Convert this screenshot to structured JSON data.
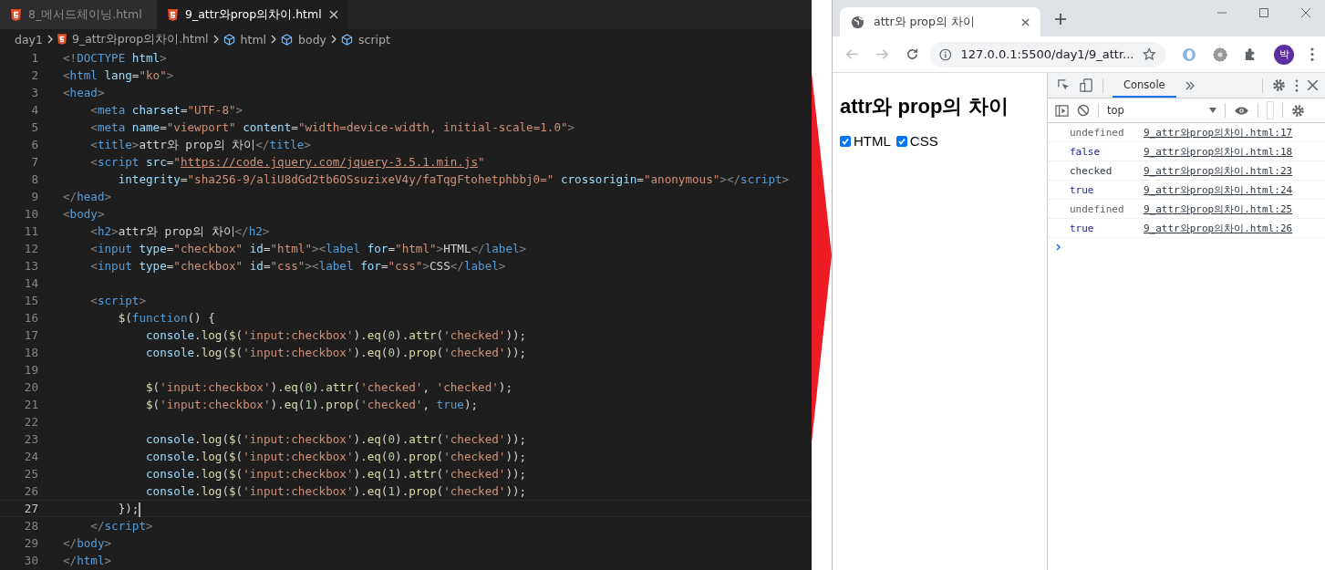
{
  "editor": {
    "tabs": [
      {
        "label": "8_메서드체이닝.html",
        "selected": false
      },
      {
        "label": "9_attr와prop의차이.html",
        "selected": true
      }
    ],
    "breadcrumb": [
      {
        "kind": "folder",
        "label": "day1"
      },
      {
        "kind": "file",
        "label": "9_attr와prop의차이.html"
      },
      {
        "kind": "symbol",
        "label": "html"
      },
      {
        "kind": "symbol",
        "label": "body"
      },
      {
        "kind": "symbol",
        "label": "script"
      }
    ],
    "lines": [
      {
        "number": "1",
        "current": false,
        "tokens": [
          {
            "kind": "punct",
            "text": "<!"
          },
          {
            "kind": "tag",
            "text": "DOCTYPE"
          },
          {
            "kind": "attr",
            "text": " html"
          },
          {
            "kind": "punct",
            "text": ">"
          }
        ]
      },
      {
        "number": "2",
        "current": false,
        "tokens": [
          {
            "kind": "punct",
            "text": "<"
          },
          {
            "kind": "tag",
            "text": "html"
          },
          {
            "kind": "attr",
            "text": " lang"
          },
          {
            "kind": "text",
            "text": "="
          },
          {
            "kind": "string",
            "text": "\"ko\""
          },
          {
            "kind": "punct",
            "text": ">"
          }
        ]
      },
      {
        "number": "3",
        "current": false,
        "tokens": [
          {
            "kind": "punct",
            "text": "<"
          },
          {
            "kind": "tag",
            "text": "head"
          },
          {
            "kind": "punct",
            "text": ">"
          }
        ]
      },
      {
        "number": "4",
        "current": false,
        "tokens": [
          {
            "kind": "punct",
            "text": "    <"
          },
          {
            "kind": "tag",
            "text": "meta"
          },
          {
            "kind": "attr",
            "text": " charset"
          },
          {
            "kind": "text",
            "text": "="
          },
          {
            "kind": "string",
            "text": "\"UTF-8\""
          },
          {
            "kind": "punct",
            "text": ">"
          }
        ]
      },
      {
        "number": "5",
        "current": false,
        "tokens": [
          {
            "kind": "punct",
            "text": "    <"
          },
          {
            "kind": "tag",
            "text": "meta"
          },
          {
            "kind": "attr",
            "text": " name"
          },
          {
            "kind": "text",
            "text": "="
          },
          {
            "kind": "string",
            "text": "\"viewport\""
          },
          {
            "kind": "attr",
            "text": " content"
          },
          {
            "kind": "text",
            "text": "="
          },
          {
            "kind": "string",
            "text": "\"width=device-width, initial-scale=1.0\""
          },
          {
            "kind": "punct",
            "text": ">"
          }
        ]
      },
      {
        "number": "6",
        "current": false,
        "tokens": [
          {
            "kind": "punct",
            "text": "    <"
          },
          {
            "kind": "tag",
            "text": "title"
          },
          {
            "kind": "punct",
            "text": ">"
          },
          {
            "kind": "text",
            "text": "attr와 prop의 차이"
          },
          {
            "kind": "punct",
            "text": "</"
          },
          {
            "kind": "tag",
            "text": "title"
          },
          {
            "kind": "punct",
            "text": ">"
          }
        ]
      },
      {
        "number": "7",
        "current": false,
        "tokens": [
          {
            "kind": "punct",
            "text": "    <"
          },
          {
            "kind": "tag",
            "text": "script"
          },
          {
            "kind": "attr",
            "text": " src"
          },
          {
            "kind": "text",
            "text": "="
          },
          {
            "kind": "string",
            "text": "\""
          },
          {
            "kind": "link",
            "text": "https://code.jquery.com/jquery-3.5.1.min.js"
          },
          {
            "kind": "string",
            "text": "\""
          }
        ]
      },
      {
        "number": "8",
        "current": false,
        "tokens": [
          {
            "kind": "attr",
            "text": "        integrity"
          },
          {
            "kind": "text",
            "text": "="
          },
          {
            "kind": "string",
            "text": "\"sha256-9/aliU8dGd2tb6OSsuzixeV4y/faTqgFtohetphbbj0=\""
          },
          {
            "kind": "attr",
            "text": " crossorigin"
          },
          {
            "kind": "text",
            "text": "="
          },
          {
            "kind": "string",
            "text": "\"anonymous\""
          },
          {
            "kind": "punct",
            "text": "></"
          },
          {
            "kind": "tag",
            "text": "script"
          },
          {
            "kind": "punct",
            "text": ">"
          }
        ]
      },
      {
        "number": "9",
        "current": false,
        "tokens": [
          {
            "kind": "punct",
            "text": "</"
          },
          {
            "kind": "tag",
            "text": "head"
          },
          {
            "kind": "punct",
            "text": ">"
          }
        ]
      },
      {
        "number": "10",
        "current": false,
        "tokens": [
          {
            "kind": "punct",
            "text": "<"
          },
          {
            "kind": "tag",
            "text": "body"
          },
          {
            "kind": "punct",
            "text": ">"
          }
        ]
      },
      {
        "number": "11",
        "current": false,
        "tokens": [
          {
            "kind": "punct",
            "text": "    <"
          },
          {
            "kind": "tag",
            "text": "h2"
          },
          {
            "kind": "punct",
            "text": ">"
          },
          {
            "kind": "text",
            "text": "attr와 prop의 차이"
          },
          {
            "kind": "punct",
            "text": "</"
          },
          {
            "kind": "tag",
            "text": "h2"
          },
          {
            "kind": "punct",
            "text": ">"
          }
        ]
      },
      {
        "number": "12",
        "current": false,
        "tokens": [
          {
            "kind": "punct",
            "text": "    <"
          },
          {
            "kind": "tag",
            "text": "input"
          },
          {
            "kind": "attr",
            "text": " type"
          },
          {
            "kind": "text",
            "text": "="
          },
          {
            "kind": "string",
            "text": "\"checkbox\""
          },
          {
            "kind": "attr",
            "text": " id"
          },
          {
            "kind": "text",
            "text": "="
          },
          {
            "kind": "string",
            "text": "\"html\""
          },
          {
            "kind": "punct",
            "text": "><"
          },
          {
            "kind": "tag",
            "text": "label"
          },
          {
            "kind": "attr",
            "text": " for"
          },
          {
            "kind": "text",
            "text": "="
          },
          {
            "kind": "string",
            "text": "\"html\""
          },
          {
            "kind": "punct",
            "text": ">"
          },
          {
            "kind": "text",
            "text": "HTML"
          },
          {
            "kind": "punct",
            "text": "</"
          },
          {
            "kind": "tag",
            "text": "label"
          },
          {
            "kind": "punct",
            "text": ">"
          }
        ]
      },
      {
        "number": "13",
        "current": false,
        "tokens": [
          {
            "kind": "punct",
            "text": "    <"
          },
          {
            "kind": "tag",
            "text": "input"
          },
          {
            "kind": "attr",
            "text": " type"
          },
          {
            "kind": "text",
            "text": "="
          },
          {
            "kind": "string",
            "text": "\"checkbox\""
          },
          {
            "kind": "attr",
            "text": " id"
          },
          {
            "kind": "text",
            "text": "="
          },
          {
            "kind": "string",
            "text": "\"css\""
          },
          {
            "kind": "punct",
            "text": "><"
          },
          {
            "kind": "tag",
            "text": "label"
          },
          {
            "kind": "attr",
            "text": " for"
          },
          {
            "kind": "text",
            "text": "="
          },
          {
            "kind": "string",
            "text": "\"css\""
          },
          {
            "kind": "punct",
            "text": ">"
          },
          {
            "kind": "text",
            "text": "CSS"
          },
          {
            "kind": "punct",
            "text": "</"
          },
          {
            "kind": "tag",
            "text": "label"
          },
          {
            "kind": "punct",
            "text": ">"
          }
        ]
      },
      {
        "number": "14",
        "current": false
      },
      {
        "number": "15",
        "current": false,
        "tokens": [
          {
            "kind": "punct",
            "text": "    <"
          },
          {
            "kind": "tag",
            "text": "script"
          },
          {
            "kind": "punct",
            "text": ">"
          }
        ]
      },
      {
        "number": "16",
        "current": false,
        "tokens": [
          {
            "kind": "func",
            "text": "        $"
          },
          {
            "kind": "text",
            "text": "("
          },
          {
            "kind": "keyword",
            "text": "function"
          },
          {
            "kind": "text",
            "text": "() {"
          }
        ]
      },
      {
        "number": "17",
        "current": false,
        "tokens": [
          {
            "kind": "attr",
            "text": "            console"
          },
          {
            "kind": "text",
            "text": "."
          },
          {
            "kind": "func",
            "text": "log"
          },
          {
            "kind": "text",
            "text": "("
          },
          {
            "kind": "func",
            "text": "$"
          },
          {
            "kind": "text",
            "text": "("
          },
          {
            "kind": "string",
            "text": "'input:checkbox'"
          },
          {
            "kind": "text",
            "text": ")."
          },
          {
            "kind": "func",
            "text": "eq"
          },
          {
            "kind": "text",
            "text": "("
          },
          {
            "kind": "number",
            "text": "0"
          },
          {
            "kind": "text",
            "text": ")."
          },
          {
            "kind": "func",
            "text": "attr"
          },
          {
            "kind": "text",
            "text": "("
          },
          {
            "kind": "string",
            "text": "'checked'"
          },
          {
            "kind": "text",
            "text": "));"
          }
        ]
      },
      {
        "number": "18",
        "current": false,
        "tokens": [
          {
            "kind": "attr",
            "text": "            console"
          },
          {
            "kind": "text",
            "text": "."
          },
          {
            "kind": "func",
            "text": "log"
          },
          {
            "kind": "text",
            "text": "("
          },
          {
            "kind": "func",
            "text": "$"
          },
          {
            "kind": "text",
            "text": "("
          },
          {
            "kind": "string",
            "text": "'input:checkbox'"
          },
          {
            "kind": "text",
            "text": ")."
          },
          {
            "kind": "func",
            "text": "eq"
          },
          {
            "kind": "text",
            "text": "("
          },
          {
            "kind": "number",
            "text": "0"
          },
          {
            "kind": "text",
            "text": ")."
          },
          {
            "kind": "func",
            "text": "prop"
          },
          {
            "kind": "text",
            "text": "("
          },
          {
            "kind": "string",
            "text": "'checked'"
          },
          {
            "kind": "text",
            "text": "));"
          }
        ]
      },
      {
        "number": "19",
        "current": false
      },
      {
        "number": "20",
        "current": false,
        "tokens": [
          {
            "kind": "func",
            "text": "            $"
          },
          {
            "kind": "text",
            "text": "("
          },
          {
            "kind": "string",
            "text": "'input:checkbox'"
          },
          {
            "kind": "text",
            "text": ")."
          },
          {
            "kind": "func",
            "text": "eq"
          },
          {
            "kind": "text",
            "text": "("
          },
          {
            "kind": "number",
            "text": "0"
          },
          {
            "kind": "text",
            "text": ")."
          },
          {
            "kind": "func",
            "text": "attr"
          },
          {
            "kind": "text",
            "text": "("
          },
          {
            "kind": "string",
            "text": "'checked'"
          },
          {
            "kind": "text",
            "text": ","
          },
          {
            "kind": "string",
            "text": " 'checked'"
          },
          {
            "kind": "text",
            "text": ");"
          }
        ]
      },
      {
        "number": "21",
        "current": false,
        "tokens": [
          {
            "kind": "func",
            "text": "            $"
          },
          {
            "kind": "text",
            "text": "("
          },
          {
            "kind": "string",
            "text": "'input:checkbox'"
          },
          {
            "kind": "text",
            "text": ")."
          },
          {
            "kind": "func",
            "text": "eq"
          },
          {
            "kind": "text",
            "text": "("
          },
          {
            "kind": "number",
            "text": "1"
          },
          {
            "kind": "text",
            "text": ")."
          },
          {
            "kind": "func",
            "text": "prop"
          },
          {
            "kind": "text",
            "text": "("
          },
          {
            "kind": "string",
            "text": "'checked'"
          },
          {
            "kind": "text",
            "text": ","
          },
          {
            "kind": "keyword",
            "text": " true"
          },
          {
            "kind": "text",
            "text": ");"
          }
        ]
      },
      {
        "number": "22",
        "current": false
      },
      {
        "number": "23",
        "current": false,
        "tokens": [
          {
            "kind": "attr",
            "text": "            console"
          },
          {
            "kind": "text",
            "text": "."
          },
          {
            "kind": "func",
            "text": "log"
          },
          {
            "kind": "text",
            "text": "("
          },
          {
            "kind": "func",
            "text": "$"
          },
          {
            "kind": "text",
            "text": "("
          },
          {
            "kind": "string",
            "text": "'input:checkbox'"
          },
          {
            "kind": "text",
            "text": ")."
          },
          {
            "kind": "func",
            "text": "eq"
          },
          {
            "kind": "text",
            "text": "("
          },
          {
            "kind": "number",
            "text": "0"
          },
          {
            "kind": "text",
            "text": ")."
          },
          {
            "kind": "func",
            "text": "attr"
          },
          {
            "kind": "text",
            "text": "("
          },
          {
            "kind": "string",
            "text": "'checked'"
          },
          {
            "kind": "text",
            "text": "));"
          }
        ]
      },
      {
        "number": "24",
        "current": false,
        "tokens": [
          {
            "kind": "attr",
            "text": "            console"
          },
          {
            "kind": "text",
            "text": "."
          },
          {
            "kind": "func",
            "text": "log"
          },
          {
            "kind": "text",
            "text": "("
          },
          {
            "kind": "func",
            "text": "$"
          },
          {
            "kind": "text",
            "text": "("
          },
          {
            "kind": "string",
            "text": "'input:checkbox'"
          },
          {
            "kind": "text",
            "text": ")."
          },
          {
            "kind": "func",
            "text": "eq"
          },
          {
            "kind": "text",
            "text": "("
          },
          {
            "kind": "number",
            "text": "0"
          },
          {
            "kind": "text",
            "text": ")."
          },
          {
            "kind": "func",
            "text": "prop"
          },
          {
            "kind": "text",
            "text": "("
          },
          {
            "kind": "string",
            "text": "'checked'"
          },
          {
            "kind": "text",
            "text": "));"
          }
        ]
      },
      {
        "number": "25",
        "current": false,
        "tokens": [
          {
            "kind": "attr",
            "text": "            console"
          },
          {
            "kind": "text",
            "text": "."
          },
          {
            "kind": "func",
            "text": "log"
          },
          {
            "kind": "text",
            "text": "("
          },
          {
            "kind": "func",
            "text": "$"
          },
          {
            "kind": "text",
            "text": "("
          },
          {
            "kind": "string",
            "text": "'input:checkbox'"
          },
          {
            "kind": "text",
            "text": ")."
          },
          {
            "kind": "func",
            "text": "eq"
          },
          {
            "kind": "text",
            "text": "("
          },
          {
            "kind": "number",
            "text": "1"
          },
          {
            "kind": "text",
            "text": ")."
          },
          {
            "kind": "func",
            "text": "attr"
          },
          {
            "kind": "text",
            "text": "("
          },
          {
            "kind": "string",
            "text": "'checked'"
          },
          {
            "kind": "text",
            "text": "));"
          }
        ]
      },
      {
        "number": "26",
        "current": false,
        "tokens": [
          {
            "kind": "attr",
            "text": "            console"
          },
          {
            "kind": "text",
            "text": "."
          },
          {
            "kind": "func",
            "text": "log"
          },
          {
            "kind": "text",
            "text": "("
          },
          {
            "kind": "func",
            "text": "$"
          },
          {
            "kind": "text",
            "text": "("
          },
          {
            "kind": "string",
            "text": "'input:checkbox'"
          },
          {
            "kind": "text",
            "text": ")."
          },
          {
            "kind": "func",
            "text": "eq"
          },
          {
            "kind": "text",
            "text": "("
          },
          {
            "kind": "number",
            "text": "1"
          },
          {
            "kind": "text",
            "text": ")."
          },
          {
            "kind": "func",
            "text": "prop"
          },
          {
            "kind": "text",
            "text": "("
          },
          {
            "kind": "string",
            "text": "'checked'"
          },
          {
            "kind": "text",
            "text": "));"
          }
        ]
      },
      {
        "number": "27",
        "current": true,
        "tokens": [
          {
            "kind": "text",
            "text": "        });"
          }
        ]
      },
      {
        "number": "28",
        "current": false,
        "tokens": [
          {
            "kind": "punct",
            "text": "    </"
          },
          {
            "kind": "tag",
            "text": "script"
          },
          {
            "kind": "punct",
            "text": ">"
          }
        ]
      },
      {
        "number": "29",
        "current": false,
        "tokens": [
          {
            "kind": "punct",
            "text": "</"
          },
          {
            "kind": "tag",
            "text": "body"
          },
          {
            "kind": "punct",
            "text": ">"
          }
        ]
      },
      {
        "number": "30",
        "current": false,
        "tokens": [
          {
            "kind": "punct",
            "text": "</"
          },
          {
            "kind": "tag",
            "text": "html"
          },
          {
            "kind": "punct",
            "text": ">"
          }
        ]
      }
    ]
  },
  "browser": {
    "tab_title": "attr와 prop의 차이",
    "url": "127.0.0.1:5500/day1/9_attr...",
    "avatar": "박",
    "page": {
      "heading": "attr와 prop의 차이",
      "checkboxes": [
        {
          "label": "HTML",
          "checked": true
        },
        {
          "label": "CSS",
          "checked": true
        }
      ]
    },
    "devtools": {
      "tabs": [
        {
          "label": "Console",
          "selected": true
        }
      ],
      "context": "top",
      "console": [
        {
          "kind": "undefined",
          "value": "undefined",
          "source": "9_attr와prop의차이.html:17"
        },
        {
          "kind": "boolean",
          "value": "false",
          "source": "9_attr와prop의차이.html:18"
        },
        {
          "kind": "string",
          "value": "checked",
          "source": "9_attr와prop의차이.html:23"
        },
        {
          "kind": "boolean",
          "value": "true",
          "source": "9_attr와prop의차이.html:24"
        },
        {
          "kind": "undefined",
          "value": "undefined",
          "source": "9_attr와prop의차이.html:25"
        },
        {
          "kind": "boolean",
          "value": "true",
          "source": "9_attr와prop의차이.html:26"
        }
      ]
    }
  }
}
